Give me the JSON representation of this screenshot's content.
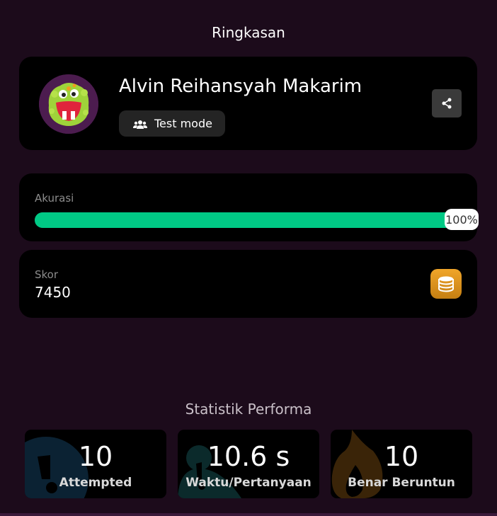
{
  "header": {
    "title": "Ringkasan"
  },
  "profile": {
    "name": "Alvin Reihansyah Makarim",
    "mode_label": "Test mode",
    "mode_icon": "users-icon",
    "share_icon": "share-icon",
    "avatar_icon": "monster-avatar"
  },
  "accuracy": {
    "label": "Akurasi",
    "value_text": "100%",
    "fraction": 1.0,
    "bar_color": "#00c985"
  },
  "score": {
    "label": "Skor",
    "value": "7450",
    "icon": "coins-icon"
  },
  "stats": {
    "title": "Statistik Performa",
    "items": [
      {
        "value": "10",
        "label": "Attempted",
        "icon": "exclamation-icon"
      },
      {
        "value": "10.6 s",
        "label": "Waktu/Pertanyaan",
        "icon": "timer-icon"
      },
      {
        "value": "10",
        "label": "Benar Beruntun",
        "icon": "flame-icon"
      }
    ]
  }
}
